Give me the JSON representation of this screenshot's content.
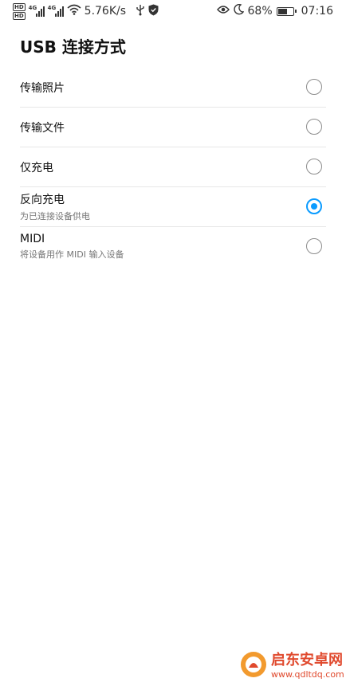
{
  "status_bar": {
    "hd1": "HD",
    "hd2": "HD",
    "sig1": "4G",
    "sig2": "4G",
    "speed": "5.76K/s",
    "battery": "68%",
    "battery_level": 0.68,
    "time": "07:16",
    "icons": [
      "signal-icon",
      "wifi-icon",
      "usb-icon",
      "shield-icon",
      "eye-icon",
      "moon-icon",
      "battery-icon"
    ]
  },
  "title": "USB 连接方式",
  "options": [
    {
      "label": "传输照片",
      "sub": "",
      "selected": false
    },
    {
      "label": "传输文件",
      "sub": "",
      "selected": false
    },
    {
      "label": "仅充电",
      "sub": "",
      "selected": false
    },
    {
      "label": "反向充电",
      "sub": "为已连接设备供电",
      "selected": true
    },
    {
      "label": "MIDI",
      "sub": "将设备用作 MIDI 输入设备",
      "selected": false
    }
  ],
  "watermark": {
    "name": "启东安卓网",
    "url": "www.qdltdq.com"
  },
  "colors": {
    "accent": "#0a9bff",
    "watermark": "#e0492d"
  }
}
